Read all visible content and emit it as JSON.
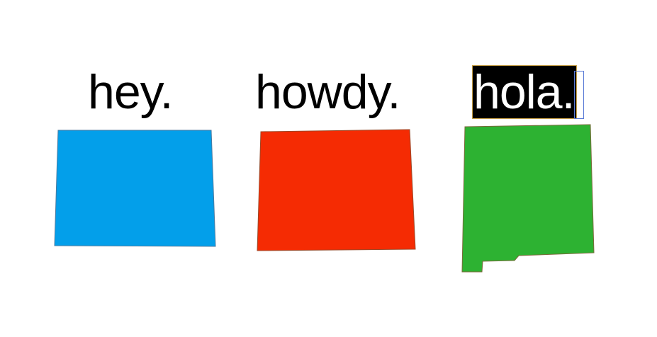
{
  "greetings": {
    "hey": "hey.",
    "howdy": "howdy.",
    "hola": "hola."
  },
  "states": {
    "wyoming": {
      "icon": "wyoming-state-icon",
      "color": "#039FEA"
    },
    "colorado": {
      "icon": "colorado-state-icon",
      "color": "#F52B03"
    },
    "new_mexico": {
      "icon": "new-mexico-state-icon",
      "color": "#2DB232"
    }
  },
  "colors": {
    "text": "#000000",
    "highlight_background": "#000000",
    "highlight_text": "#FFFFFF",
    "outline": "#7a6a3a"
  }
}
